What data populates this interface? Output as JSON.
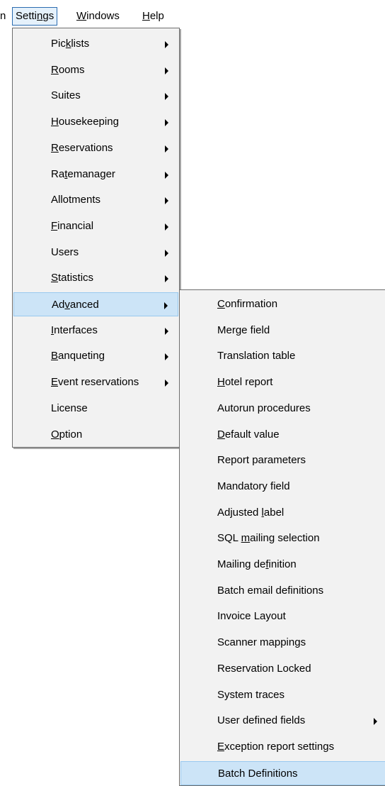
{
  "menubar": {
    "edge_glyph": "n",
    "items": [
      {
        "pre": "Setti",
        "acc": "n",
        "post": "gs"
      },
      {
        "pre": "",
        "acc": "W",
        "post": "indows"
      },
      {
        "pre": "",
        "acc": "H",
        "post": "elp"
      }
    ]
  },
  "settings_menu": {
    "items": [
      {
        "pre": "Pic",
        "acc": "k",
        "post": "lists",
        "submenu": true
      },
      {
        "pre": "",
        "acc": "R",
        "post": "ooms",
        "submenu": true
      },
      {
        "pre": "Suites",
        "acc": "",
        "post": "",
        "submenu": true
      },
      {
        "pre": "",
        "acc": "H",
        "post": "ousekeeping",
        "submenu": true
      },
      {
        "pre": "",
        "acc": "R",
        "post": "eservations",
        "submenu": true
      },
      {
        "pre": "Ra",
        "acc": "t",
        "post": "emanager",
        "submenu": true
      },
      {
        "pre": "Allotments",
        "acc": "",
        "post": "",
        "submenu": true
      },
      {
        "pre": "",
        "acc": "F",
        "post": "inancial",
        "submenu": true
      },
      {
        "pre": "Users",
        "acc": "",
        "post": "",
        "submenu": true
      },
      {
        "pre": "",
        "acc": "S",
        "post": "tatistics",
        "submenu": true
      },
      {
        "pre": "Ad",
        "acc": "v",
        "post": "anced",
        "submenu": true,
        "selected": true
      },
      {
        "pre": "",
        "acc": "I",
        "post": "nterfaces",
        "submenu": true
      },
      {
        "pre": "",
        "acc": "B",
        "post": "anqueting",
        "submenu": true
      },
      {
        "pre": "",
        "acc": "E",
        "post": "vent reservations",
        "submenu": true
      },
      {
        "pre": "License",
        "acc": "",
        "post": "",
        "submenu": false
      },
      {
        "pre": "",
        "acc": "O",
        "post": "ption",
        "submenu": false
      }
    ]
  },
  "advanced_menu": {
    "items": [
      {
        "pre": "",
        "acc": "C",
        "post": "onfirmation"
      },
      {
        "pre": "Merge field",
        "acc": "",
        "post": ""
      },
      {
        "pre": "Translation table",
        "acc": "",
        "post": ""
      },
      {
        "pre": "",
        "acc": "H",
        "post": "otel report"
      },
      {
        "pre": "Autorun procedures",
        "acc": "",
        "post": ""
      },
      {
        "pre": "",
        "acc": "D",
        "post": "efault value"
      },
      {
        "pre": "Report parameters",
        "acc": "",
        "post": ""
      },
      {
        "pre": "Mandatory field",
        "acc": "",
        "post": ""
      },
      {
        "pre": "Adjusted ",
        "acc": "l",
        "post": "abel"
      },
      {
        "pre": "SQL ",
        "acc": "m",
        "post": "ailing selection"
      },
      {
        "pre": "Mailing de",
        "acc": "f",
        "post": "inition"
      },
      {
        "pre": "Batch email definitions",
        "acc": "",
        "post": ""
      },
      {
        "pre": "Invoice Layout",
        "acc": "",
        "post": ""
      },
      {
        "pre": "Scanner mappings",
        "acc": "",
        "post": ""
      },
      {
        "pre": "Reservation Locked",
        "acc": "",
        "post": ""
      },
      {
        "pre": "System traces",
        "acc": "",
        "post": ""
      },
      {
        "pre": "User defined fields",
        "acc": "",
        "post": "",
        "submenu": true
      },
      {
        "pre": "",
        "acc": "E",
        "post": "xception report settings"
      },
      {
        "pre": "Batch Definitions",
        "acc": "",
        "post": "",
        "selected": true
      }
    ]
  }
}
